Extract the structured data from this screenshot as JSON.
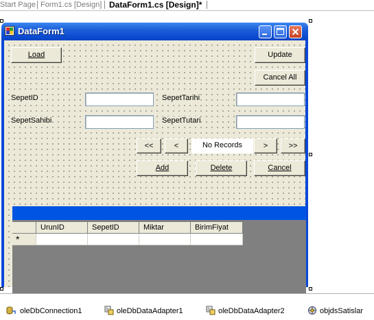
{
  "tabs": [
    {
      "label": "Start Page",
      "active": false
    },
    {
      "label": "Form1.cs [Design]",
      "active": false
    },
    {
      "label": "DataForm1.cs [Design]*",
      "active": true
    }
  ],
  "window": {
    "title": "DataForm1"
  },
  "buttons": {
    "load": "Load",
    "update": "Update",
    "cancel_all": "Cancel All",
    "add": "Add",
    "delete": "Delete",
    "cancel": "Cancel"
  },
  "fields": {
    "sepet_id": "SepetID",
    "sepet_tarihi": "SepetTarihi",
    "sepet_sahibi": "SepetSahibi",
    "sepet_tutari": "SepetTutari"
  },
  "navigation": {
    "first": "<<",
    "prev": "<",
    "status": "No Records",
    "next": ">",
    "last": ">>"
  },
  "grid": {
    "columns": [
      "UrunID",
      "SepetID",
      "Miktar",
      "BirimFiyat"
    ],
    "new_row_marker": "*"
  },
  "components": [
    "oleDbConnection1",
    "oleDbDataAdapter1",
    "oleDbDataAdapter2",
    "objdsSatislar"
  ],
  "colors": {
    "titlebar": "#0a48d8",
    "form_bg": "#ece9d8",
    "grid_caption": "#0054e3",
    "grid_bg": "#808080"
  }
}
